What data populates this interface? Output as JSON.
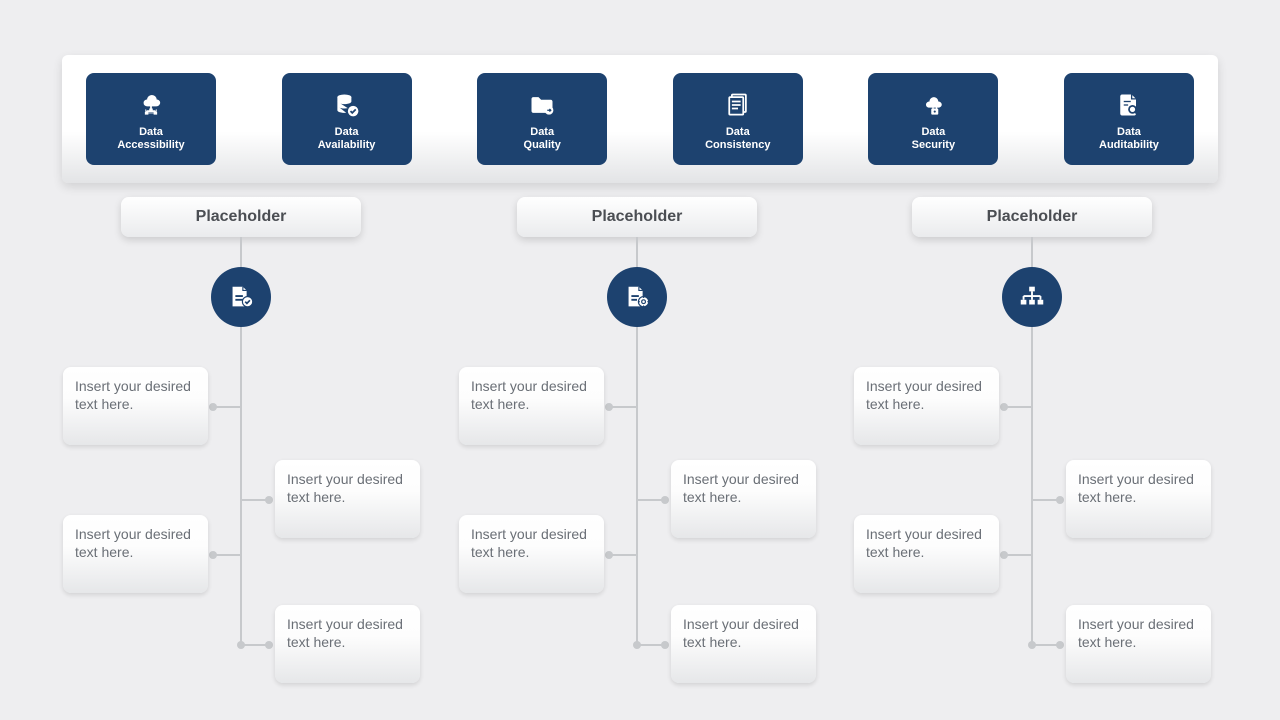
{
  "banner": {
    "pillars": [
      {
        "line1": "Data",
        "line2": "Accessibility"
      },
      {
        "line1": "Data",
        "line2": "Availability"
      },
      {
        "line1": "Data",
        "line2": "Quality"
      },
      {
        "line1": "Data",
        "line2": "Consistency"
      },
      {
        "line1": "Data",
        "line2": "Security"
      },
      {
        "line1": "Data",
        "line2": "Auditability"
      }
    ]
  },
  "sections": [
    {
      "title": "Placeholder",
      "notes": [
        "Insert your desired text here.",
        "Insert your desired text here.",
        "Insert your desired text here.",
        "Insert your desired text here."
      ]
    },
    {
      "title": "Placeholder",
      "notes": [
        "Insert your desired text here.",
        "Insert your desired text here.",
        "Insert your desired text here.",
        "Insert your desired text here."
      ]
    },
    {
      "title": "Placeholder",
      "notes": [
        "Insert your desired text here.",
        "Insert your desired text here.",
        "Insert your desired text here.",
        "Insert your desired text here."
      ]
    }
  ]
}
